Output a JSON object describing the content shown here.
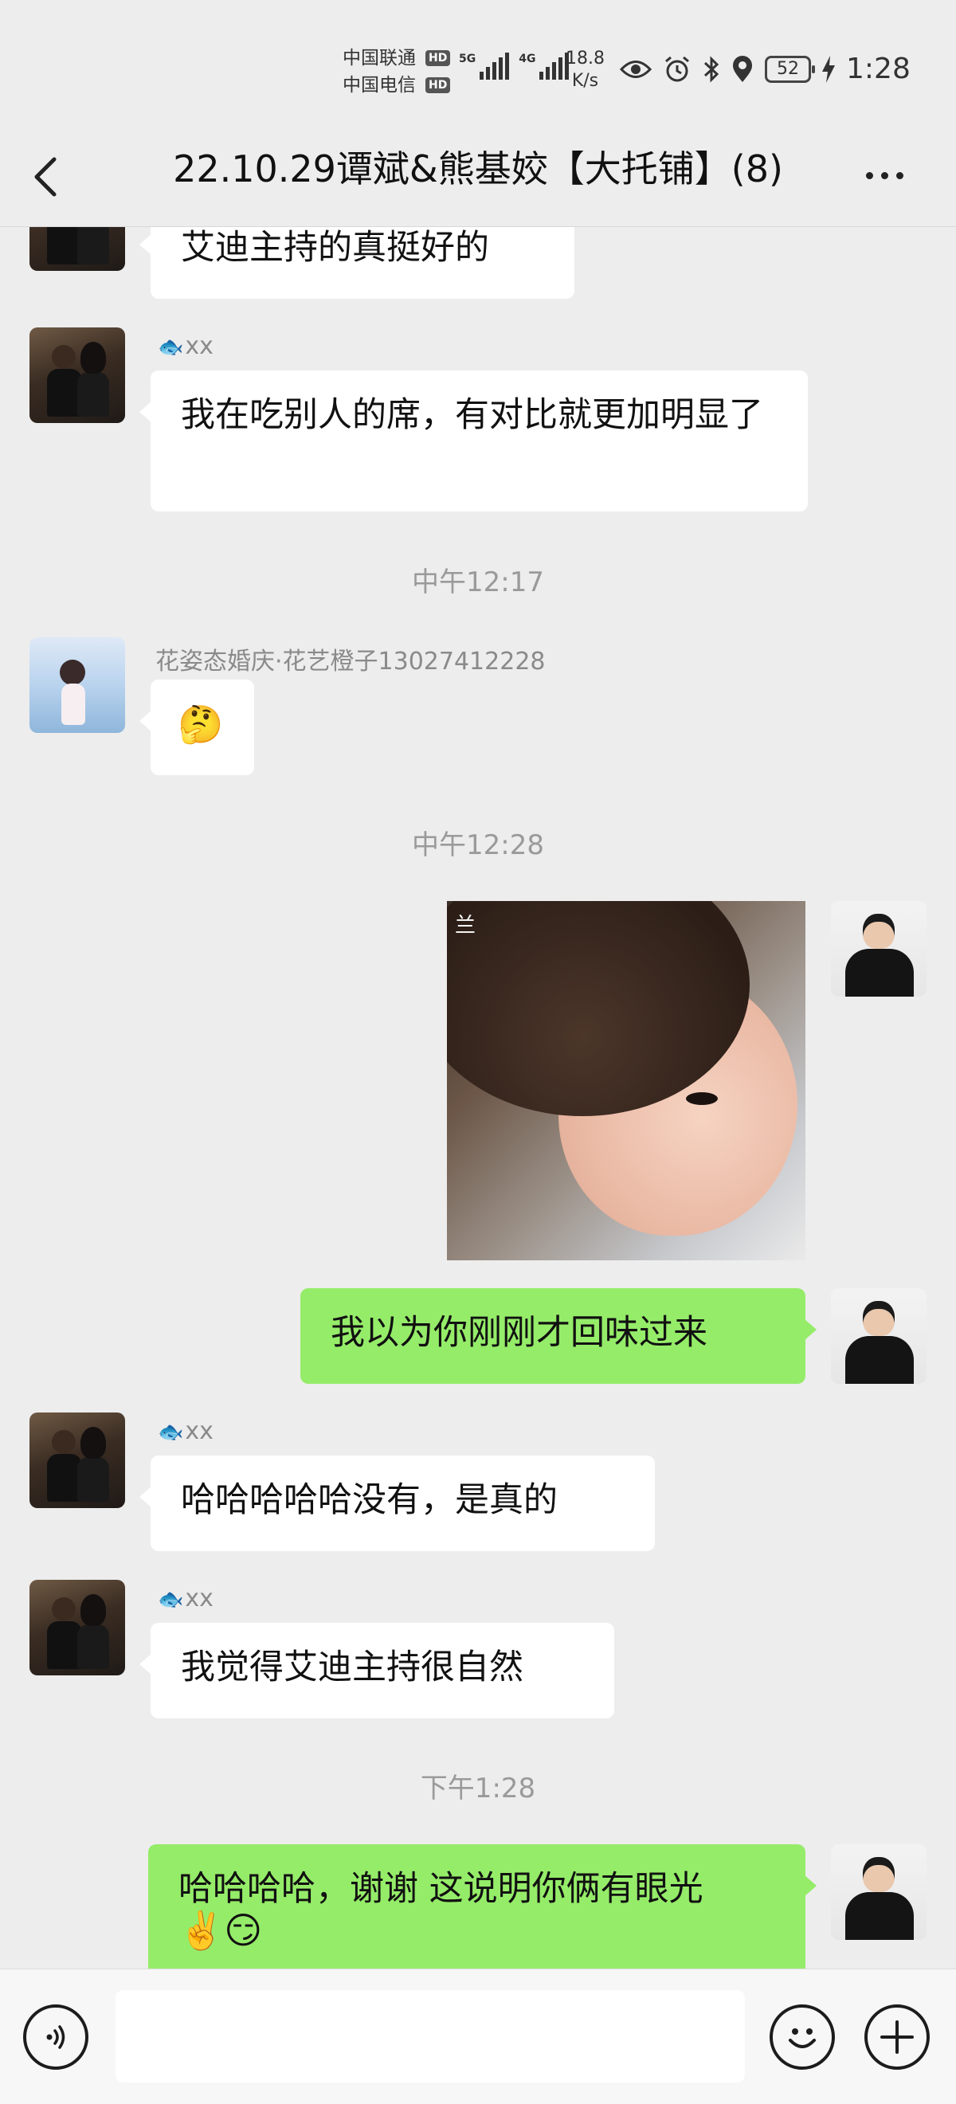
{
  "status_bar": {
    "carrier1": "中国联通",
    "carrier2": "中国电信",
    "hd": "HD",
    "signal1": "5G",
    "signal2": "4G",
    "speed_value": "18.8",
    "speed_unit": "K/s",
    "battery": "52",
    "time": "1:28"
  },
  "header": {
    "title": "22.10.29谭斌&熊基姣【大托铺】(8)"
  },
  "messages": {
    "m1": {
      "text": "艾迪主持的真挺好的"
    },
    "m2": {
      "sender": "xx",
      "text": "我在吃别人的席，有对比就更加明显了"
    },
    "t1": "中午12:17",
    "m3": {
      "sender": "花姿态婚庆·花艺橙子13027412228",
      "emoji": "🤔"
    },
    "t2": "中午12:28",
    "m4": {
      "watermark": "兰"
    },
    "m5": {
      "text": "我以为你刚刚才回味过来"
    },
    "m6": {
      "sender": "xx",
      "text": "哈哈哈哈哈没有，是真的"
    },
    "m7": {
      "sender": "xx",
      "text": "我觉得艾迪主持很自然"
    },
    "t3": "下午1:28",
    "m8": {
      "text": "哈哈哈哈，谢谢 这说明你俩有眼光",
      "emoji": "✌️😏"
    }
  },
  "input": {
    "value": ""
  },
  "icons": {
    "fish": "🐟",
    "back": "back-chevron-icon",
    "more": "more-dots-icon",
    "voice": "voice-icon",
    "emoji": "smiley-icon",
    "plus": "plus-icon"
  },
  "colors": {
    "background": "#ededed",
    "self_bubble": "#95ec69",
    "other_bubble": "#ffffff"
  }
}
